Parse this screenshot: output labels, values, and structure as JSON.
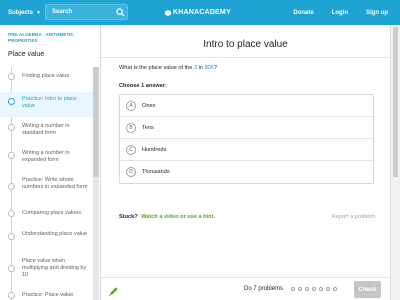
{
  "topbar": {
    "subjects_label": "Subjects",
    "search_placeholder": "Search",
    "logo_text": "KHANACADEMY",
    "links": [
      "Donate",
      "Login",
      "Sign up"
    ]
  },
  "sidebar": {
    "breadcrumb": "PRE-ALGEBRA · ARITHMETIC PROPERTIES",
    "title": "Place value",
    "items": [
      {
        "label": "Finding place value",
        "active": false
      },
      {
        "label": "Practice: Intro to place value",
        "active": true
      },
      {
        "label": "Writing a number in standard form",
        "active": false
      },
      {
        "label": "Writing a number in expanded form",
        "active": false
      },
      {
        "label": "Practice: Write whole numbers in expanded form",
        "active": false
      },
      {
        "label": "Comparing place values",
        "active": false
      },
      {
        "label": "Understanding place value",
        "active": false
      },
      {
        "label": "Place value when multiplying and dividing by 10",
        "active": false
      },
      {
        "label": "Practice: Place value",
        "active": false
      }
    ]
  },
  "exercise": {
    "title": "Intro to place value",
    "question_prefix": "What is the place value of the",
    "question_digit": "3",
    "question_mid": "in",
    "question_number": "806",
    "question_suffix": "?",
    "choose_label": "Choose 1 answer:",
    "choices": [
      {
        "letter": "A",
        "text": "Ones"
      },
      {
        "letter": "B",
        "text": "Tens"
      },
      {
        "letter": "C",
        "text": "Hundreds"
      },
      {
        "letter": "D",
        "text": "Thousands"
      }
    ],
    "stuck_label": "Stuck?",
    "hint_label": "Watch a video or use a hint.",
    "report_label": "Report a problem"
  },
  "footer": {
    "problems_label": "Do 7 problems",
    "check_label": "Check"
  },
  "colors": {
    "brand": "#1ea3d2",
    "hint": "#59a817",
    "check_disabled": "#c3c6c9"
  }
}
